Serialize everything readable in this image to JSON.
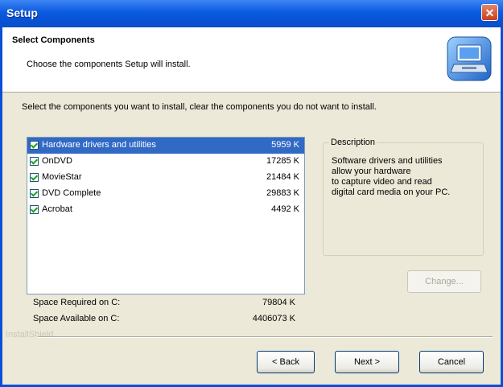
{
  "window": {
    "title": "Setup",
    "close_glyph": "✕"
  },
  "header": {
    "title": "Select Components",
    "subtitle": "Choose the components Setup will install.",
    "icon": "computer-install-icon"
  },
  "instruction": "Select the components you want to install, clear the components you do not want to install.",
  "components": [
    {
      "name": "Hardware drivers and utilities",
      "size": "5959 K",
      "checked": true,
      "selected": true
    },
    {
      "name": "OnDVD",
      "size": "17285 K",
      "checked": true,
      "selected": false
    },
    {
      "name": "MovieStar",
      "size": "21484 K",
      "checked": true,
      "selected": false
    },
    {
      "name": "DVD Complete",
      "size": "29883 K",
      "checked": true,
      "selected": false
    },
    {
      "name": "Acrobat",
      "size": "4492 K",
      "checked": true,
      "selected": false
    }
  ],
  "description": {
    "label": "Description",
    "text": "Software drivers and utilities\nallow your hardware\nto capture video and read\ndigital card media on your PC."
  },
  "change_button": "Change...",
  "space": {
    "required_label": "Space Required on  C:",
    "required_value": "79804 K",
    "available_label": "Space Available on  C:",
    "available_value": "4406073 K"
  },
  "brand": "InstallShield",
  "buttons": {
    "back": "< Back",
    "next": "Next >",
    "cancel": "Cancel"
  },
  "colors": {
    "selection": "#316ac5",
    "titlebar": "#0a5ae0"
  }
}
